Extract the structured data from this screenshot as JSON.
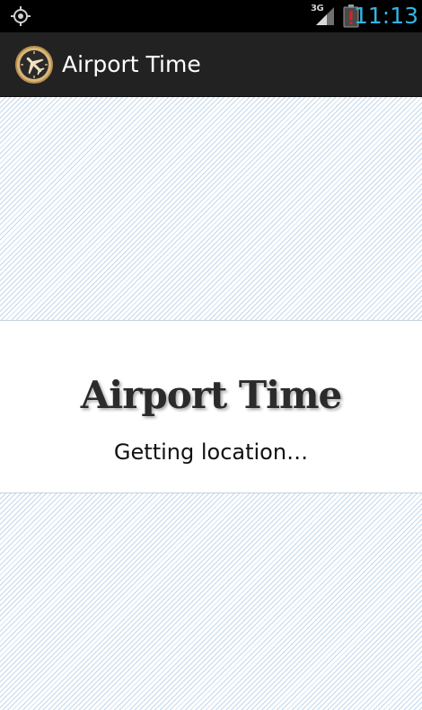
{
  "status_bar": {
    "network_type": "3G",
    "time": "11:13",
    "icons": [
      "gps-icon",
      "signal-icon",
      "battery-alert-icon"
    ],
    "clock_color": "#33b5e5"
  },
  "action_bar": {
    "title": "Airport Time",
    "logo_icon": "airplane-clock-icon"
  },
  "splash": {
    "title": "Airport Time",
    "status": "Getting location…"
  },
  "colors": {
    "status_bar_bg": "#000000",
    "action_bar_bg": "#222222",
    "stripe": "#c3d8ec",
    "panel_bg": "#ffffff"
  }
}
